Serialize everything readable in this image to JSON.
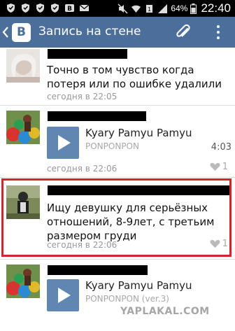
{
  "status_bar": {
    "battery": "64%",
    "time": "22:40"
  },
  "header": {
    "logo": "В",
    "title": "Запись на стене",
    "icons": [
      "back-arrow-icon",
      "vk-logo-icon",
      "paperclip-icon",
      "overflow-menu-icon"
    ]
  },
  "posts": [
    {
      "text": "Точно в том чувство когда потеря или по ошибке удалили",
      "time": "сегодня в 22:05"
    },
    {
      "audio": {
        "artist": "Kyary Pamyu Pamyu",
        "title": "PONPONPON",
        "duration": "4:03"
      },
      "time": "сегодня в 22:06",
      "likes": "1"
    },
    {
      "text": "Ищу девушку для серьёзных отношений, 8-9лет, с третьим размером груди",
      "time": "сегодня в 22:06",
      "likes": "1"
    },
    {
      "audio": {
        "artist": "Kyary Pamyu Pamyu",
        "title": "PONPONPON (ver.3)"
      }
    }
  ],
  "watermark": "YAPLAKAL.COM",
  "colors": {
    "header_bg": "#4b6f9a",
    "play_button": "#5f87b2",
    "highlight": "#d2262f"
  }
}
